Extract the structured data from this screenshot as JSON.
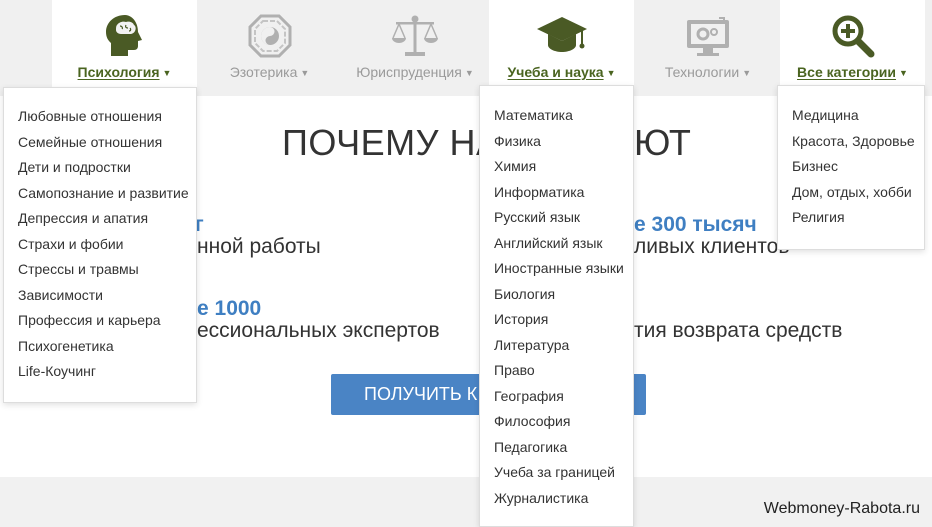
{
  "nav": {
    "items": [
      {
        "label": "Психология",
        "icon": "head-brain-icon",
        "active": true
      },
      {
        "label": "Эзотерика",
        "icon": "bagua-icon",
        "active": false
      },
      {
        "label": "Юриспруденция",
        "icon": "scales-icon",
        "active": false
      },
      {
        "label": "Учеба и наука",
        "icon": "graduation-cap-icon",
        "active": true
      },
      {
        "label": "Технологии",
        "icon": "monitor-gear-icon",
        "active": false
      },
      {
        "label": "Все категории",
        "icon": "magnifier-plus-icon",
        "active": true
      }
    ],
    "colors": {
      "active_label": "#4a6420",
      "inactive_label": "#9a9a9a",
      "active_icon": "#4a5a25",
      "inactive_icon": "#b0b0b0"
    }
  },
  "main": {
    "headline_left": "ПОЧЕМУ НА",
    "headline_right": "ЮТ",
    "stats": {
      "s1_value": "г",
      "s1_text": "нной работы",
      "s2_value": "е 300 тысяч",
      "s2_text": "ливых клиентов",
      "s3_value": "е 1000",
      "s3_text": "ессиональных экспертов",
      "s4_text": "тия возврата средств"
    },
    "cta_label": "ПОЛУЧИТЬ К",
    "accent_color": "#3f7fc2"
  },
  "dropdowns": {
    "psychology": [
      "Любовные отношения",
      "Семейные отношения",
      "Дети и подростки",
      "Самопознание и развитие",
      "Депрессия и апатия",
      "Страхи и фобии",
      "Стрессы и травмы",
      "Зависимости",
      "Профессия и карьера",
      "Психогенетика",
      "Life-Коучинг"
    ],
    "study": [
      "Математика",
      "Физика",
      "Химия",
      "Информатика",
      "Русский язык",
      "Английский язык",
      "Иностранные языки",
      "Биология",
      "История",
      "Литература",
      "Право",
      "География",
      "Философия",
      "Педагогика",
      "Учеба за границей",
      "Журналистика"
    ],
    "all": [
      "Медицина",
      "Красота, Здоровье",
      "Бизнес",
      "Дом, отдых, хобби",
      "Религия"
    ]
  },
  "watermark": "Webmoney-Rabota.ru"
}
